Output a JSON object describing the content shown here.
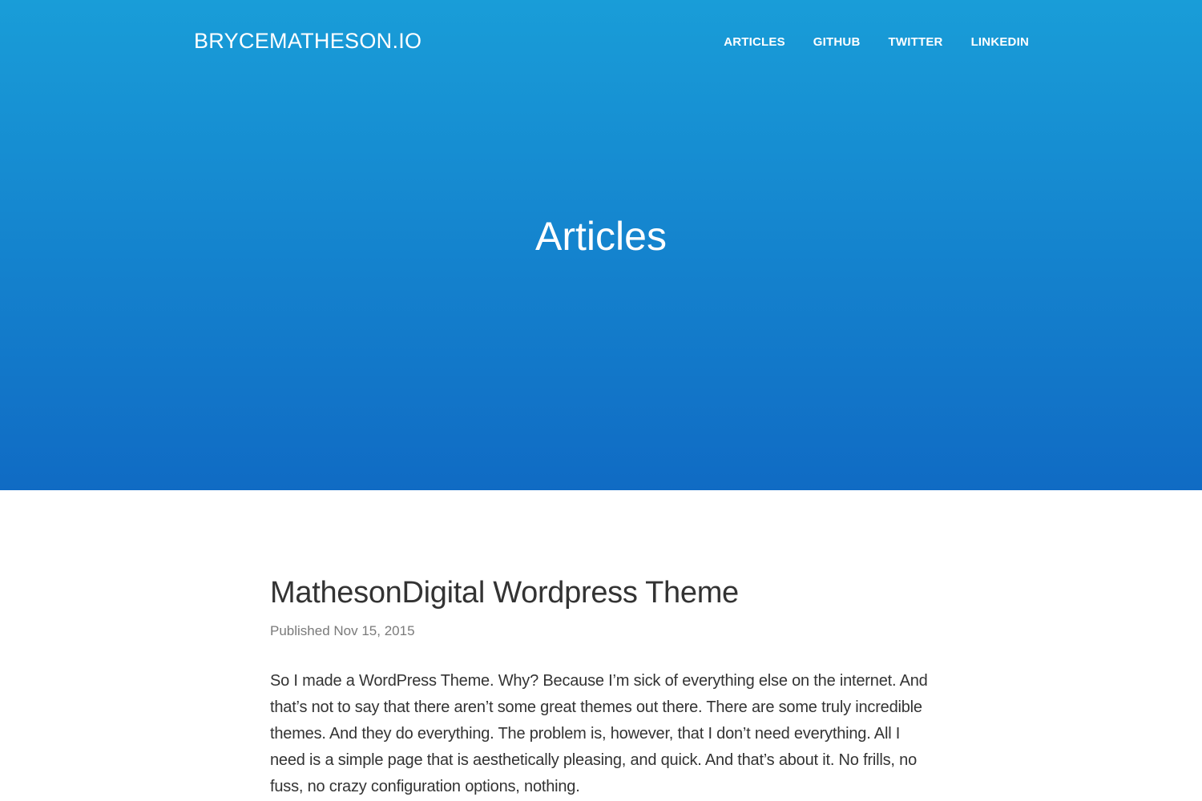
{
  "site": {
    "brand": "BRYCEMATHESON.IO"
  },
  "nav": {
    "items": [
      {
        "label": "ARTICLES"
      },
      {
        "label": "GITHUB"
      },
      {
        "label": "TWITTER"
      },
      {
        "label": "LINKEDIN"
      }
    ]
  },
  "hero": {
    "title": "Articles",
    "gradient_top": "#199dd8",
    "gradient_bottom": "#106bc4"
  },
  "post": {
    "title": "MathesonDigital Wordpress Theme",
    "date": "Published Nov 15, 2015",
    "excerpt": "So I made a WordPress Theme. Why? Because I’m sick of everything else on the internet. And that’s not to say that there aren’t some great themes out there. There are some truly incredible themes. And they do everything. The problem is, however, that I don’t need everything. All I need is a simple page that is aesthetically pleasing, and quick. And that’s about it. No frills, no fuss, no crazy configuration options, nothing."
  }
}
